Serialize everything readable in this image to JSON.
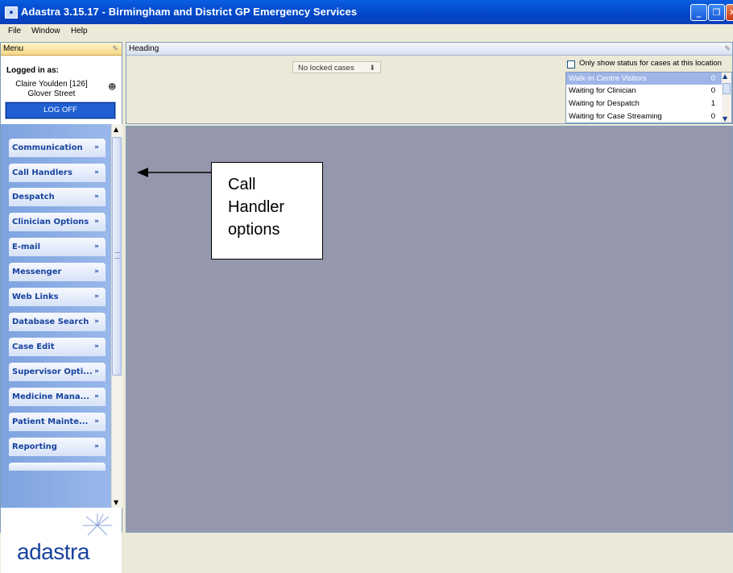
{
  "window": {
    "title": "Adastra 3.15.17 - Birmingham and District GP Emergency Services"
  },
  "menubar": [
    "File",
    "Window",
    "Help"
  ],
  "left_panel": {
    "header": "Menu",
    "logged_in_label": "Logged in as:",
    "user": "Claire Youlden [126]",
    "location": "Glover Street",
    "logoff_label": "LOG OFF",
    "items": [
      "Communication",
      "Call Handlers",
      "Despatch",
      "Clinician Options",
      "E-mail",
      "Messenger",
      "Web Links",
      "Database Search",
      "Case Edit",
      "Supervisor Opti...",
      "Medicine Mana...",
      "Patient Mainte...",
      "Reporting"
    ],
    "logo_text": "adastra"
  },
  "heading_panel": {
    "header": "Heading",
    "locked_cases": "No locked cases",
    "status_checkbox_label": "Only show status for cases at this location",
    "status_checked": false,
    "status_rows": [
      {
        "label": "Walk-In Centre Visitors",
        "count": "0",
        "selected": true
      },
      {
        "label": "Waiting for Clinician",
        "count": "0",
        "selected": false
      },
      {
        "label": "Waiting for Despatch",
        "count": "1",
        "selected": false
      },
      {
        "label": "Waiting for Case Streaming",
        "count": "0",
        "selected": false
      }
    ]
  },
  "annotation": {
    "lines": [
      "Call",
      "Handler",
      "options"
    ]
  },
  "colors": {
    "titlebar": "#0347c9",
    "menu_text": "#17439e",
    "workspace": "#9598ad",
    "logoff": "#1f5fd1"
  }
}
